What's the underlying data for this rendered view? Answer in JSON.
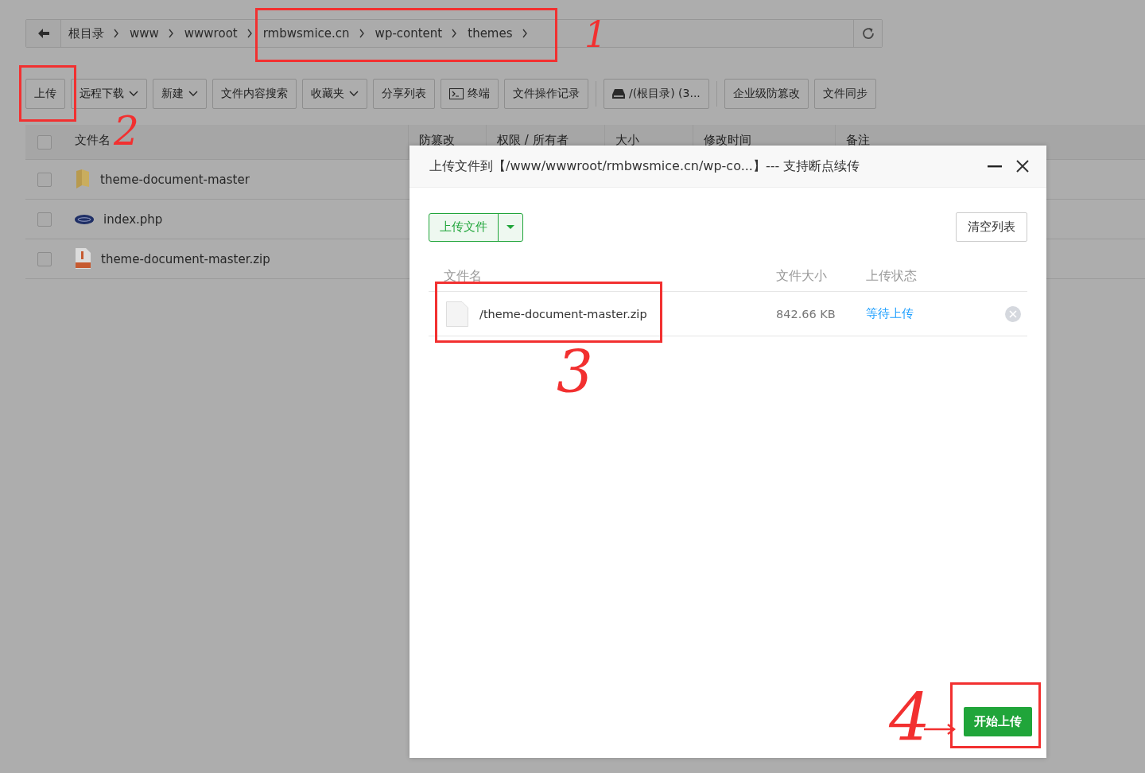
{
  "breadcrumb": {
    "items": [
      "根目录",
      "www",
      "wwwroot",
      "rmbwsmice.cn",
      "wp-content",
      "themes"
    ]
  },
  "toolbar": [
    [
      {
        "label": "上传",
        "kind": "button"
      },
      {
        "label": "远程下载",
        "kind": "dropdown"
      },
      {
        "label": "新建",
        "kind": "dropdown"
      },
      {
        "label": "文件内容搜索",
        "kind": "button"
      },
      {
        "label": "收藏夹",
        "kind": "dropdown"
      },
      {
        "label": "分享列表",
        "kind": "button"
      },
      {
        "label": "终端",
        "kind": "terminal"
      },
      {
        "label": "文件操作记录",
        "kind": "button"
      }
    ],
    [
      {
        "label": "/(根目录) (3...",
        "kind": "disk"
      }
    ],
    [
      {
        "label": "企业级防篡改",
        "kind": "button"
      },
      {
        "label": "文件同步",
        "kind": "button"
      }
    ]
  ],
  "table": {
    "select_all": {
      "checked": false
    },
    "columns": [
      "文件名",
      "防篡改",
      "权限 / 所有者",
      "大小",
      "修改时间",
      "备注"
    ],
    "rows": [
      {
        "name": "theme-document-master",
        "kind": "folder",
        "checked": false
      },
      {
        "name": "index.php",
        "kind": "php",
        "checked": false
      },
      {
        "name": "theme-document-master.zip",
        "kind": "zip",
        "checked": false
      }
    ]
  },
  "upload_dialog": {
    "title": "上传文件到【/www/wwwroot/rmbwsmice.cn/wp-co...】--- 支持断点续传",
    "upload_button": "上传文件",
    "clear_button": "清空列表",
    "columns": [
      "文件名",
      "文件大小",
      "上传状态"
    ],
    "files": [
      {
        "name": "/theme-document-master.zip",
        "size": "842.66 KB",
        "status": "等待上传"
      }
    ],
    "start_button": "开始上传"
  },
  "annotations": [
    {
      "kind": "box"
    },
    {
      "kind": "number",
      "text": "1"
    },
    {
      "kind": "box"
    },
    {
      "kind": "number",
      "text": "2"
    },
    {
      "kind": "box"
    },
    {
      "kind": "number",
      "text": "3"
    },
    {
      "kind": "box"
    },
    {
      "kind": "number",
      "text": "4"
    }
  ]
}
